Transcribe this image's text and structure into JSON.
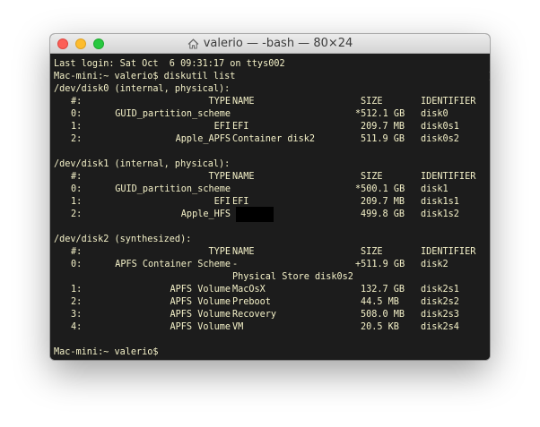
{
  "window": {
    "title": "valerio — -bash — 80×24",
    "title_icon": "home-icon"
  },
  "terminal": {
    "last_login": "Last login: Sat Oct  6 09:31:17 on ttys002",
    "prompt_command": "Mac-mini:~ valerio$ diskutil list",
    "final_prompt": "Mac-mini:~ valerio$",
    "headers": {
      "num": "#:",
      "type": "TYPE",
      "name": "NAME",
      "size": "SIZE",
      "identifier": "IDENTIFIER"
    },
    "disks": [
      {
        "header": "/dev/disk0 (internal, physical):",
        "rows": [
          {
            "num": "0:",
            "type": "GUID_partition_scheme",
            "name": "",
            "size": "*512.1 GB",
            "identifier": "disk0"
          },
          {
            "num": "1:",
            "type": "EFI",
            "name": "EFI",
            "size": "209.7 MB",
            "identifier": "disk0s1"
          },
          {
            "num": "2:",
            "type": "Apple_APFS",
            "name": "Container disk2",
            "size": "511.9 GB",
            "identifier": "disk0s2"
          }
        ]
      },
      {
        "header": "/dev/disk1 (internal, physical):",
        "rows": [
          {
            "num": "0:",
            "type": "GUID_partition_scheme",
            "name": "",
            "size": "*500.1 GB",
            "identifier": "disk1"
          },
          {
            "num": "1:",
            "type": "EFI",
            "name": "EFI",
            "size": "209.7 MB",
            "identifier": "disk1s1"
          },
          {
            "num": "2:",
            "type": "Apple_HFS",
            "name": "",
            "size": "499.8 GB",
            "identifier": "disk1s2",
            "redacted": true
          }
        ]
      },
      {
        "header": "/dev/disk2 (synthesized):",
        "rows": [
          {
            "num": "0:",
            "type": "APFS Container Scheme",
            "name": "-",
            "size": "+511.9 GB",
            "identifier": "disk2"
          },
          {
            "num": "",
            "type": "",
            "name": "Physical Store disk0s2",
            "size": "",
            "identifier": ""
          },
          {
            "num": "1:",
            "type": "APFS Volume",
            "name": "MacOsX",
            "size": "132.7 GB",
            "identifier": "disk2s1"
          },
          {
            "num": "2:",
            "type": "APFS Volume",
            "name": "Preboot",
            "size": "44.5 MB",
            "identifier": "disk2s2"
          },
          {
            "num": "3:",
            "type": "APFS Volume",
            "name": "Recovery",
            "size": "508.0 MB",
            "identifier": "disk2s3"
          },
          {
            "num": "4:",
            "type": "APFS Volume",
            "name": "VM",
            "size": "20.5 KB",
            "identifier": "disk2s4"
          }
        ]
      }
    ]
  },
  "colors": {
    "terminal_bg": "#1c1c1c",
    "terminal_fg": "#f4f1c8",
    "close": "#fc5f57",
    "minimize": "#fdbc2e",
    "maximize": "#28c840"
  }
}
